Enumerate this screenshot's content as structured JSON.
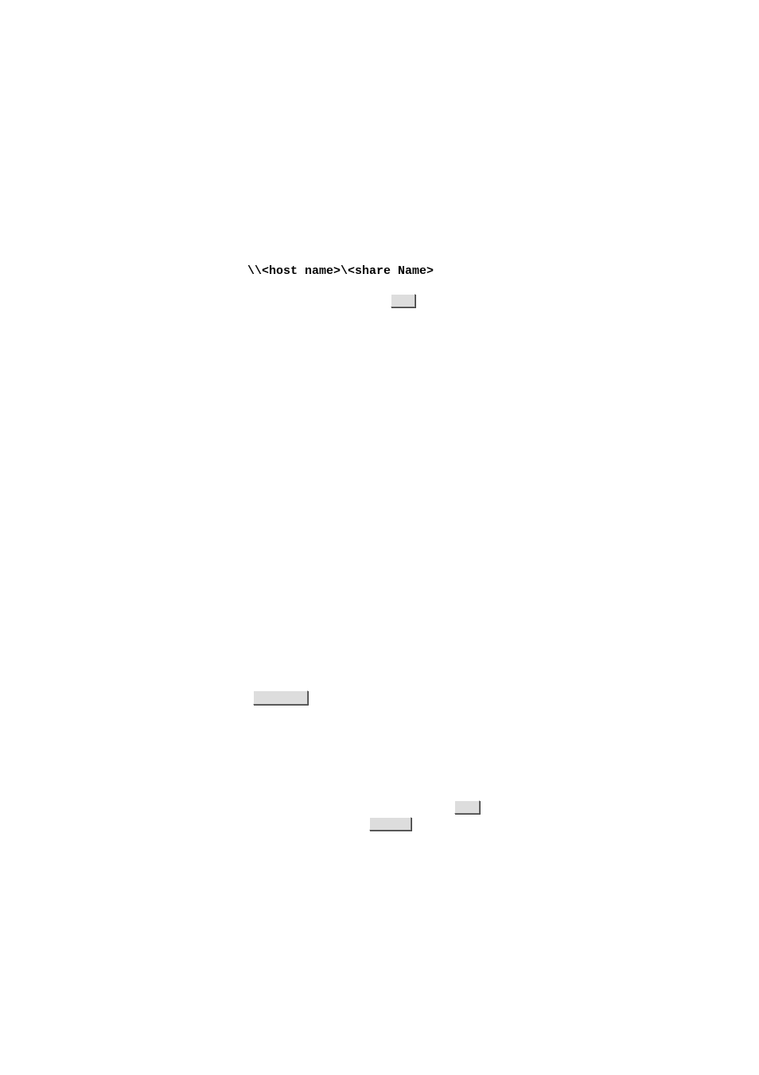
{
  "code": {
    "line1": "\\\\<host name>\\<share Name>"
  },
  "buttons": {
    "b1": "",
    "b2": "",
    "b3": "",
    "b4": ""
  }
}
